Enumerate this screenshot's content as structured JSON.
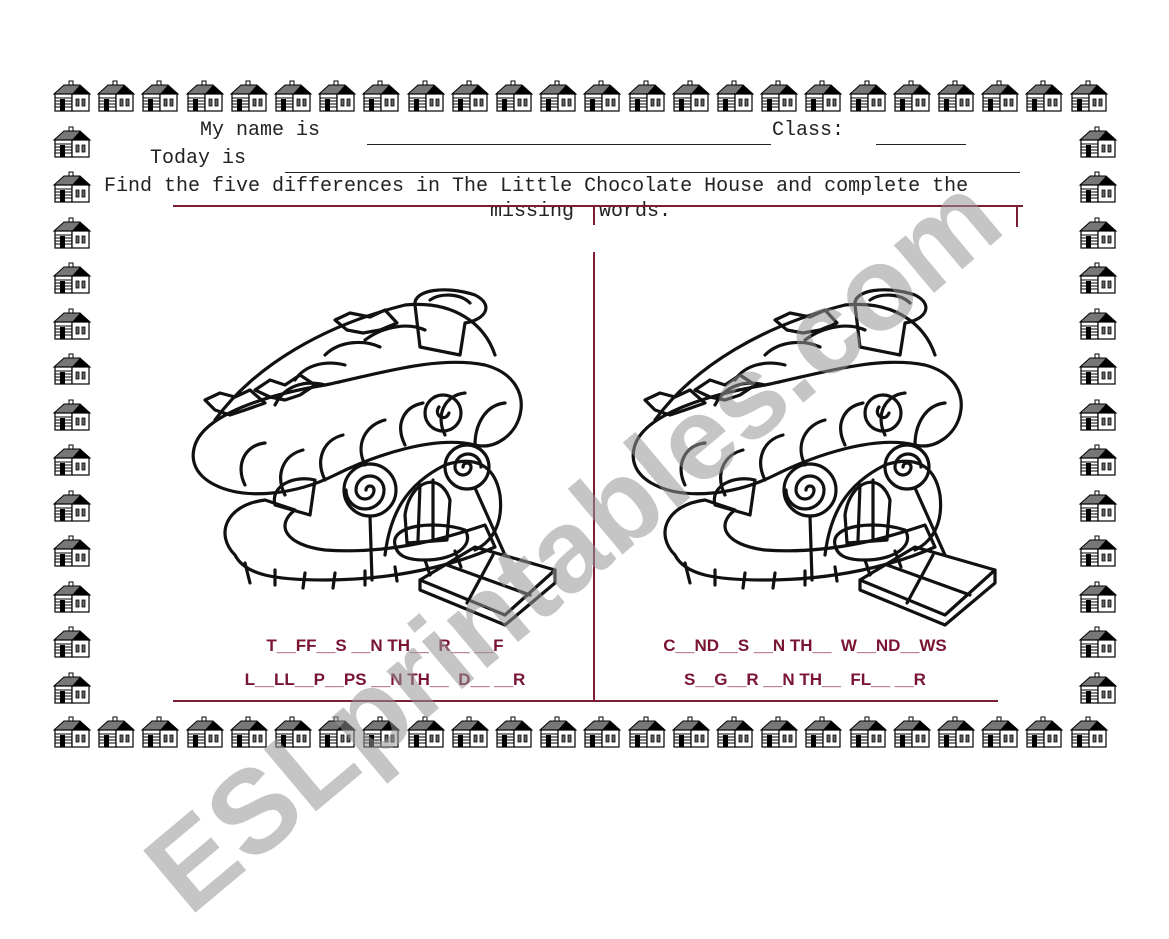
{
  "worksheet": {
    "name_label": "My name is",
    "class_label": "Class:",
    "date_label": "Today is",
    "instruction_line1": "Find the five differences in The Little Chocolate House and complete the",
    "instruction_line2_left": "missing",
    "instruction_line2_right": "words."
  },
  "left_panel": {
    "illustration": "chocolate-candy-house",
    "puzzles": [
      "T__FF__S __N TH__  R__ __F",
      "L__LL__P__PS __N TH__  D__ __R"
    ]
  },
  "right_panel": {
    "illustration": "chocolate-candy-house",
    "puzzles": [
      "C__ND__S __N TH__  W__ND__WS",
      "S__G__R __N TH__  FL__ __R"
    ]
  },
  "border": {
    "icon": "house-icon"
  },
  "watermark": {
    "text": "ESLprintables.com"
  },
  "colors": {
    "accent_red": "#7a1f33",
    "text": "#222222"
  }
}
